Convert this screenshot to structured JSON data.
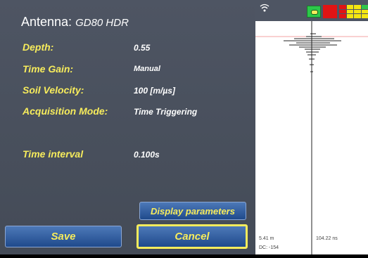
{
  "header": {
    "antenna_label": "Antenna:",
    "antenna_model": "GD80 HDR"
  },
  "fields": [
    {
      "label": "Depth:",
      "value": "0.55"
    },
    {
      "label": "Time Gain:",
      "value": "Manual"
    },
    {
      "label": "Soil Velocity:",
      "value": "100 [m/µs]"
    },
    {
      "label": "Acquisition Mode:",
      "value": "Time Triggering"
    },
    {
      "label": "Time interval",
      "value": "0.100s"
    }
  ],
  "buttons": {
    "display_parameters": "Display parameters",
    "save": "Save",
    "cancel": "Cancel"
  },
  "radar_footer": {
    "distance": "5.41 m",
    "time": "104.22 ns",
    "dc": "DC: -154"
  },
  "colors": {
    "label": "#f7ec5c",
    "panel": "#4e5563",
    "button": "#2a5ea8",
    "record": "#e11414"
  }
}
